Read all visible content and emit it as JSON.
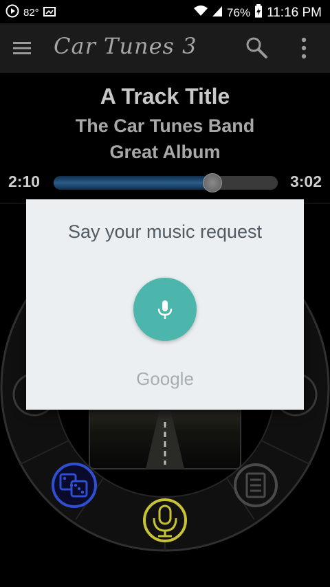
{
  "status_bar": {
    "temperature": "82°",
    "battery": "76%",
    "time": "11:16 PM"
  },
  "app_bar": {
    "title": "Car Tunes 3"
  },
  "now_playing": {
    "track_title": "A Track Title",
    "artist": "The Car Tunes Band",
    "album": "Great Album",
    "elapsed": "2:10",
    "duration": "3:02",
    "progress_fraction": 0.71
  },
  "voice_dialog": {
    "prompt": "Say your music request",
    "brand": "Google"
  },
  "colors": {
    "mic_fab": "#4db6ac",
    "dice_button": "#2f4fd0",
    "voice_button": "#c8c234",
    "dialog_bg": "#eceff1"
  },
  "icons": {
    "status": [
      "play-circle-icon",
      "image-icon",
      "wifi-icon",
      "signal-icon",
      "battery-icon"
    ],
    "app_bar": [
      "menu-icon",
      "search-icon",
      "more-vert-icon"
    ],
    "wheel": [
      "dice-icon",
      "microphone-icon",
      "list-icon"
    ]
  }
}
